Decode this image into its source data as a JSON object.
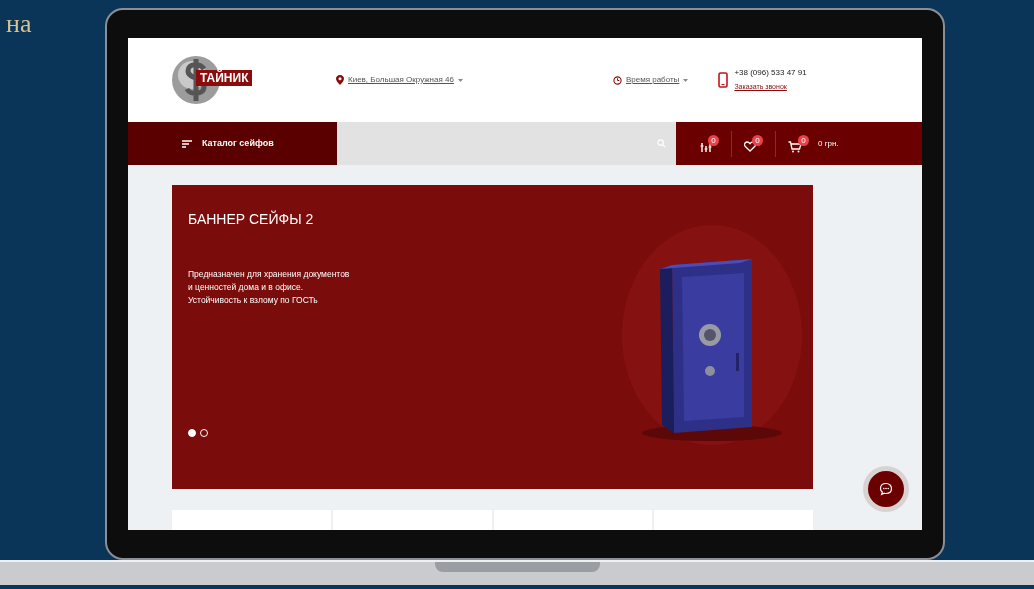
{
  "side_text": "на",
  "header": {
    "logo_text": "ТАЙНИК",
    "address": "Киев, Большая Окружная 46",
    "hours": "Время работы",
    "phone": "+38 (096) 533 47 91",
    "callback": "Заказать звонок"
  },
  "nav": {
    "catalog": "Каталог сейфов",
    "counters": [
      {
        "kind": "compare",
        "badge": "0"
      },
      {
        "kind": "wishlist",
        "badge": "0"
      },
      {
        "kind": "cart",
        "badge": "0",
        "total": "0 грн."
      }
    ]
  },
  "banner": {
    "title": "БАННЕР СЕЙФЫ 2",
    "text": "Предназначен для хранения документов и ценностей дома и в офисе. Устойчивость к взлому по ГОСТь",
    "dots": [
      {
        "selected": true
      },
      {
        "selected": false
      }
    ]
  }
}
